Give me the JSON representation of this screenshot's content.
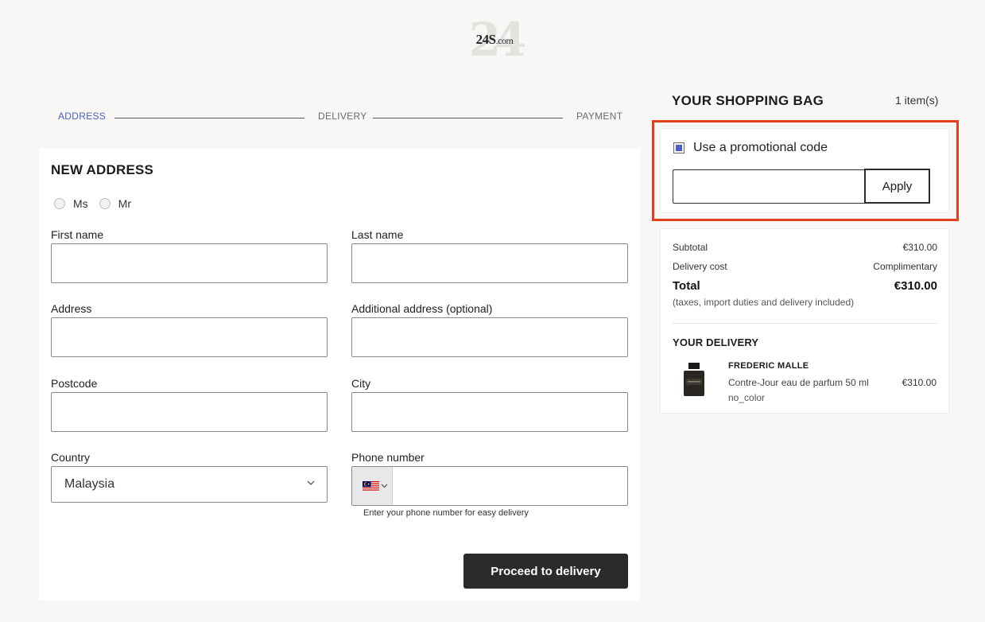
{
  "logo": {
    "text": "24S",
    "suffix": ".com"
  },
  "steps": [
    {
      "label": "ADDRESS",
      "active": true
    },
    {
      "label": "DELIVERY",
      "active": false
    },
    {
      "label": "PAYMENT",
      "active": false
    }
  ],
  "form": {
    "title": "NEW ADDRESS",
    "titles": [
      "Ms",
      "Mr"
    ],
    "fields": {
      "first_name": {
        "label": "First name",
        "value": ""
      },
      "last_name": {
        "label": "Last name",
        "value": ""
      },
      "address": {
        "label": "Address",
        "value": ""
      },
      "additional_address": {
        "label": "Additional address (optional)",
        "value": ""
      },
      "postcode": {
        "label": "Postcode",
        "value": ""
      },
      "city": {
        "label": "City",
        "value": ""
      },
      "country": {
        "label": "Country",
        "value": "Malaysia"
      },
      "phone": {
        "label": "Phone number",
        "value": "",
        "hint": "Enter your phone number for easy delivery",
        "flag_icon": "malaysia-flag-icon"
      }
    },
    "submit_label": "Proceed to delivery"
  },
  "bag": {
    "title": "YOUR SHOPPING BAG",
    "count": "1 item(s)",
    "promo": {
      "label": "Use a promotional code",
      "checked": true,
      "input_value": "",
      "apply_label": "Apply"
    },
    "summary": {
      "subtotal_label": "Subtotal",
      "subtotal_value": "€310.00",
      "delivery_label": "Delivery cost",
      "delivery_value": "Complimentary",
      "total_label": "Total",
      "total_value": "€310.00",
      "note": "(taxes, import duties and delivery included)"
    },
    "delivery": {
      "title": "YOUR DELIVERY",
      "item": {
        "brand": "FREDERIC MALLE",
        "name": "Contre-Jour eau de parfum 50 ml",
        "color": "no_color",
        "price": "€310.00"
      }
    }
  },
  "colors": {
    "accent": "#4a5fc1",
    "highlight": "#e2401c",
    "button": "#2b2b2b"
  }
}
